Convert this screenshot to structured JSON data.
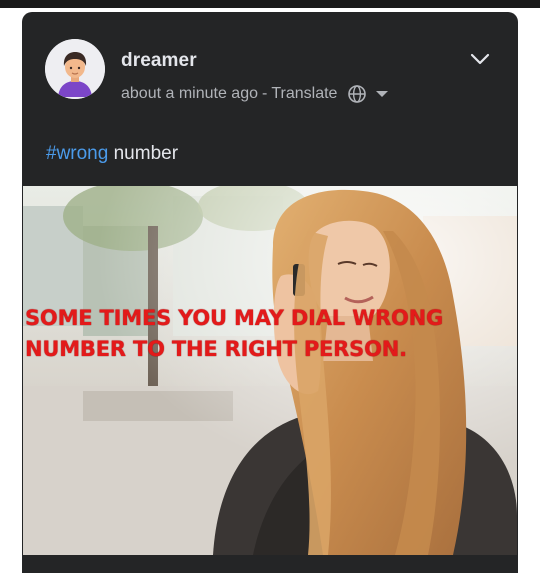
{
  "post": {
    "username": "dreamer",
    "timestamp": "about a minute ago",
    "separator": "-",
    "translate_label": "Translate",
    "text": {
      "hashtag": "#wrong",
      "rest": " number"
    },
    "image": {
      "overlay_line_1": "SOME TIMES YOU MAY DIAL WRONG",
      "overlay_line_2": "NUMBER TO THE RIGHT PERSON."
    }
  },
  "icons": {
    "avatar": "user-avatar-icon",
    "audience": "globe-icon",
    "audience_menu": "caret-down-icon",
    "post_menu": "chevron-down-icon"
  },
  "colors": {
    "card_background": "#242526",
    "primary_text": "#e4e6eb",
    "secondary_text": "#b0b3b8",
    "hashtag": "#4b9bea",
    "overlay_text": "#e31a1a"
  }
}
